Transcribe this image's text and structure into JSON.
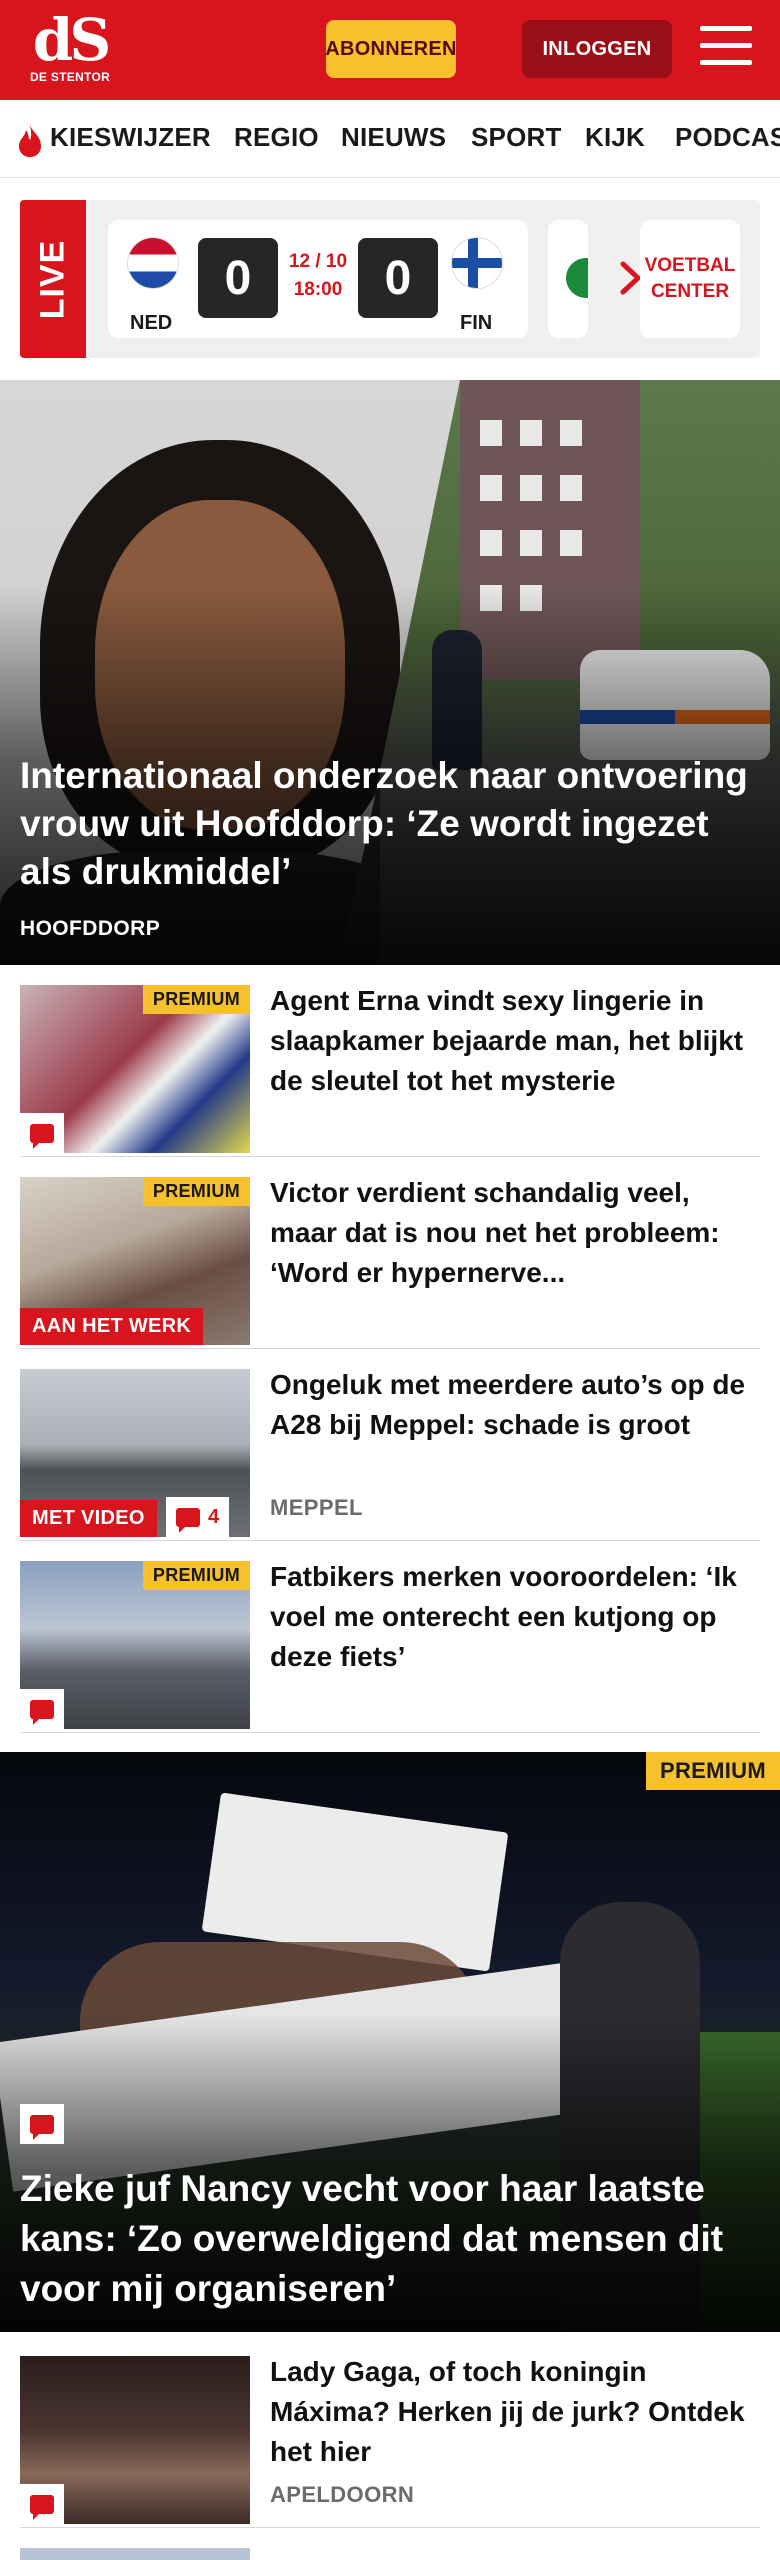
{
  "header": {
    "logo_mark": "dS",
    "logo_name": "DE STENTOR",
    "subscribe_label": "ABONNEREN",
    "login_label": "INLOGGEN",
    "menu_icon": "hamburger-icon",
    "brand_color": "#d8141c"
  },
  "nav": {
    "items": [
      {
        "label": "KIESWIJZER",
        "icon": "flame-icon"
      },
      {
        "label": "REGIO"
      },
      {
        "label": "NIEUWS"
      },
      {
        "label": "SPORT"
      },
      {
        "label": "KIJK"
      },
      {
        "label": "PODCAS"
      }
    ]
  },
  "live": {
    "label": "LIVE",
    "match": {
      "home_code": "NED",
      "away_code": "FIN",
      "home_score": "0",
      "away_score": "0",
      "date": "12 / 10",
      "time": "18:00"
    },
    "voetbal_center_label": "VOETBAL CENTER"
  },
  "hero": {
    "title": "Internationaal onderzoek naar ontvoering vrouw uit Hoofddorp: ‘Ze wordt ingezet als drukmiddel’",
    "location": "HOOFDDORP"
  },
  "articles": [
    {
      "title": "Agent Erna vindt sexy lingerie in slaapkamer bejaarde man, het blijkt de sleutel tot het mysterie",
      "premium": "PREMIUM",
      "has_comments": true
    },
    {
      "title": "Victor verdient schandalig veel, maar dat is nou net het probleem: ‘Word er hypernerve...",
      "premium": "PREMIUM",
      "tag": "AAN HET WERK"
    },
    {
      "title": "Ongeluk met meerdere auto’s op de A28 bij Meppel: schade is groot",
      "tag": "MET VIDEO",
      "comment_count": "4",
      "location": "MEPPEL"
    },
    {
      "title": "Fatbikers merken vooroordelen: ‘Ik voel me onterecht een kutjong op deze fiets’",
      "premium": "PREMIUM",
      "has_comments": true
    }
  ],
  "featured": {
    "premium": "PREMIUM",
    "title": "Zieke juf Nancy vecht voor haar laatste kans: ‘Zo overweldigend dat mensen dit voor mij organiseren’"
  },
  "article_after": {
    "title": "Lady Gaga, of toch koningin Máxima? Herken jij de jurk? Ontdek het hier",
    "location": "APELDOORN",
    "has_comments": true
  }
}
